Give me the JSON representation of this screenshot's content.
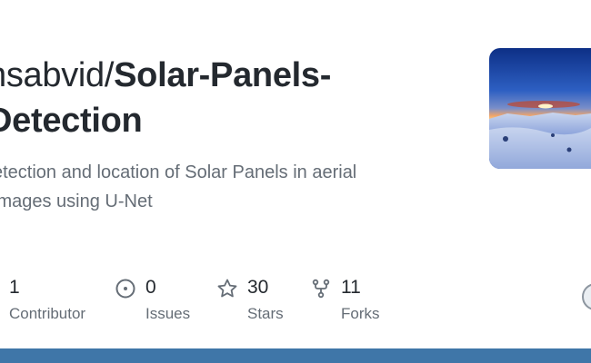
{
  "repo": {
    "owner_prefix": "nsabvid/",
    "name": "Solar-Panels-Detection",
    "description": "etection and location of Solar Panels in aerial images using U-Net"
  },
  "stats": [
    {
      "icon": "people-icon",
      "value": "1",
      "label": "Contributor"
    },
    {
      "icon": "issue-opened-icon",
      "value": "0",
      "label": "Issues"
    },
    {
      "icon": "star-icon",
      "value": "30",
      "label": "Stars"
    },
    {
      "icon": "repo-forked-icon",
      "value": "11",
      "label": "Forks"
    }
  ],
  "colors": {
    "text": "#24292f",
    "muted": "#656d76",
    "bottom_bar": "#3f76a8"
  }
}
